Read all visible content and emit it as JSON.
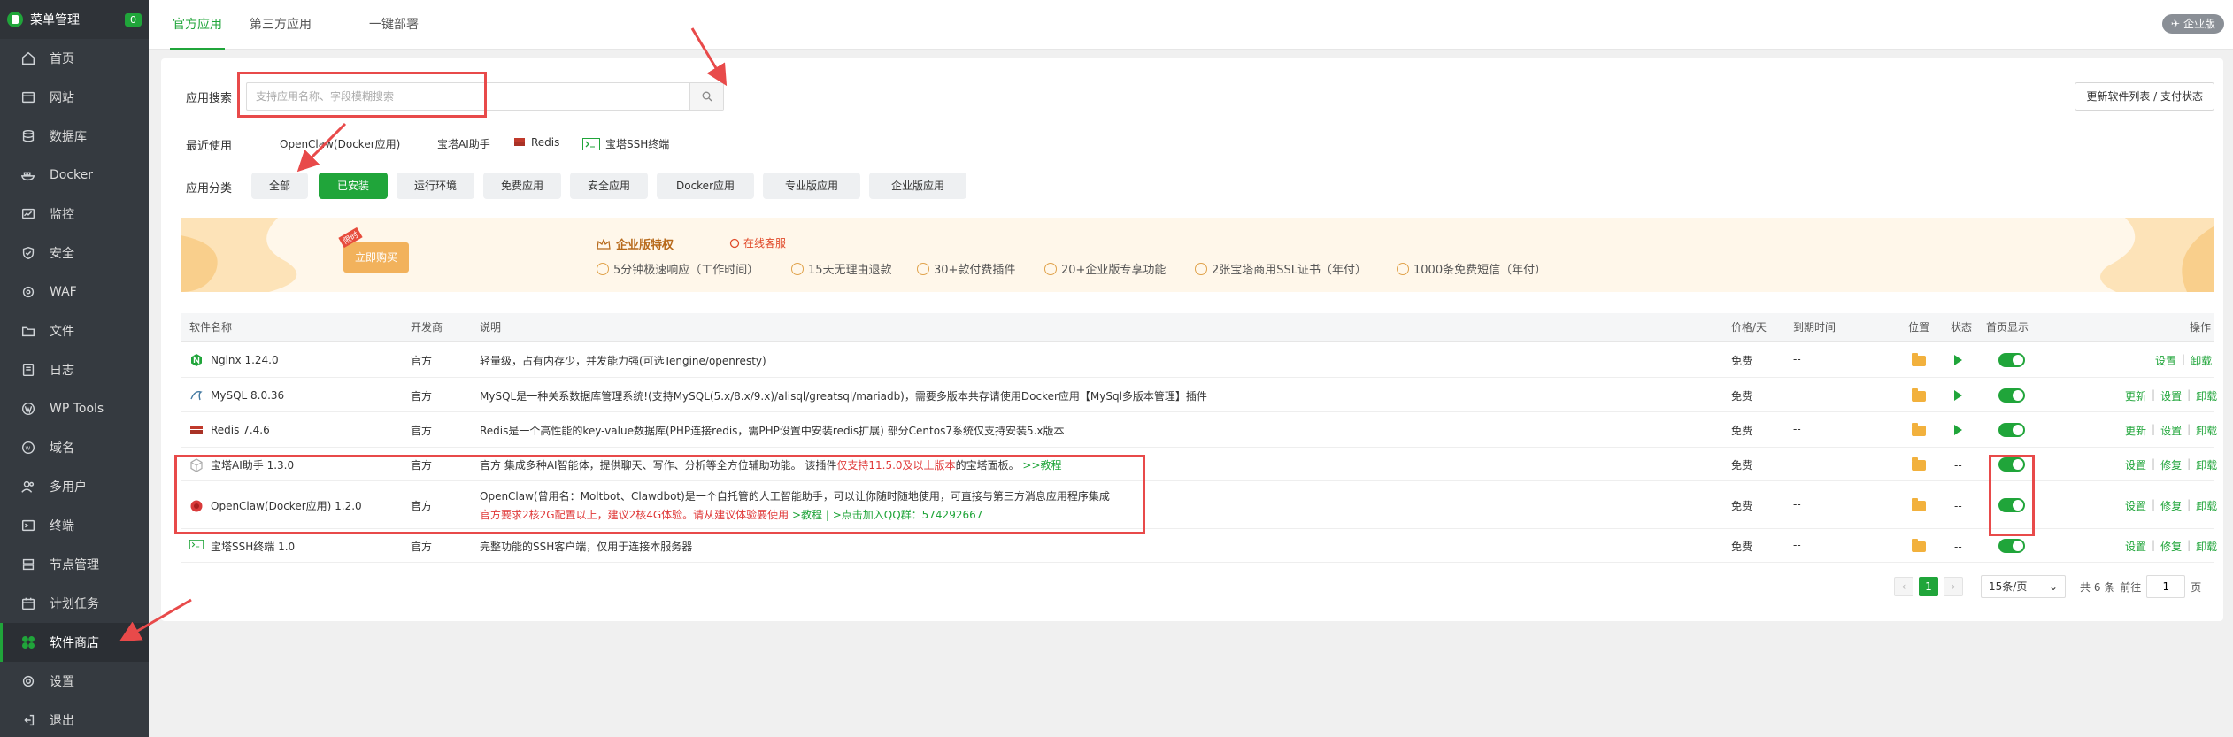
{
  "sidebar": {
    "title": "菜单管理",
    "badge": "0",
    "items": [
      {
        "label": "首页",
        "icon": "home-icon"
      },
      {
        "label": "网站",
        "icon": "website-icon"
      },
      {
        "label": "数据库",
        "icon": "database-icon"
      },
      {
        "label": "Docker",
        "icon": "docker-icon"
      },
      {
        "label": "监控",
        "icon": "monitor-icon"
      },
      {
        "label": "安全",
        "icon": "shield-icon"
      },
      {
        "label": "WAF",
        "icon": "waf-icon"
      },
      {
        "label": "文件",
        "icon": "folder-icon"
      },
      {
        "label": "日志",
        "icon": "log-icon"
      },
      {
        "label": "WP Tools",
        "icon": "wordpress-icon"
      },
      {
        "label": "域名",
        "icon": "domain-icon"
      },
      {
        "label": "多用户",
        "icon": "users-icon"
      },
      {
        "label": "终端",
        "icon": "terminal-icon"
      },
      {
        "label": "节点管理",
        "icon": "node-icon"
      },
      {
        "label": "计划任务",
        "icon": "calendar-icon"
      },
      {
        "label": "软件商店",
        "icon": "store-icon",
        "active": true
      },
      {
        "label": "设置",
        "icon": "gear-icon"
      },
      {
        "label": "退出",
        "icon": "logout-icon"
      }
    ]
  },
  "top_tabs": [
    "官方应用",
    "第三方应用",
    "一键部署"
  ],
  "enterprise_badge": "企业版",
  "search": {
    "label": "应用搜索",
    "placeholder": "支持应用名称、字段模糊搜索"
  },
  "update_button": "更新软件列表 / 支付状态",
  "recent": {
    "label": "最近使用",
    "items": [
      "OpenClaw(Docker应用)",
      "宝塔AI助手",
      "Redis",
      "宝塔SSH终端"
    ]
  },
  "categories": {
    "label": "应用分类",
    "items": [
      "全部",
      "已安装",
      "运行环境",
      "免费应用",
      "安全应用",
      "Docker应用",
      "专业版应用",
      "企业版应用"
    ],
    "active": "已安装"
  },
  "banner": {
    "button": "立即购买",
    "tag": "限时",
    "title": "企业版特权",
    "service": "在线客服",
    "features": [
      "5分钟极速响应（工作时间）",
      "15天无理由退款",
      "30+款付费插件",
      "20+企业版专享功能",
      "2张宝塔商用SSL证书（年付）",
      "1000条免费短信（年付）"
    ]
  },
  "table": {
    "headers": [
      "软件名称",
      "开发商",
      "说明",
      "价格/天",
      "到期时间",
      "位置",
      "状态",
      "首页显示",
      "操作"
    ],
    "rows": [
      {
        "name": "Nginx 1.24.0",
        "vendor": "官方",
        "desc": "轻量级，占有内存少，并发能力强(可选Tengine/openresty)",
        "price": "免费",
        "expire": "--",
        "status": "play",
        "ops": [
          "设置",
          "卸载"
        ]
      },
      {
        "name": "MySQL 8.0.36",
        "vendor": "官方",
        "desc": "MySQL是一种关系数据库管理系统!(支持MySQL(5.x/8.x/9.x)/alisql/greatsql/mariadb)，需要多版本共存请使用Docker应用【MySql多版本管理】插件",
        "price": "免费",
        "expire": "--",
        "status": "play",
        "ops": [
          "更新",
          "设置",
          "卸载"
        ]
      },
      {
        "name": "Redis 7.4.6",
        "vendor": "官方",
        "desc": "Redis是一个高性能的key-value数据库(PHP连接redis，需PHP设置中安装redis扩展) 部分Centos7系统仅支持安装5.x版本",
        "price": "免费",
        "expire": "--",
        "status": "play",
        "ops": [
          "更新",
          "设置",
          "卸载"
        ]
      },
      {
        "name": "宝塔AI助手 1.3.0",
        "vendor": "官方",
        "desc": "官方 集成多种AI智能体，提供聊天、写作、分析等全方位辅助功能。 该插件",
        "desc_red": "仅支持11.5.0及以上版本",
        "desc_tail": "的宝塔面板。",
        "desc_link": ">>教程",
        "price": "免费",
        "expire": "--",
        "status": "--",
        "ops": [
          "设置",
          "修复",
          "卸载"
        ]
      },
      {
        "name": "OpenClaw(Docker应用) 1.2.0",
        "vendor": "官方",
        "desc": "OpenClaw(曾用名：Moltbot、Clawdbot)是一个自托管的人工智能助手，可以让你随时随地使用，可直接与第三方消息应用程序集成",
        "desc2_red": "官方要求2核2G配置以上，建议2核4G体验。请从建议体验要使用",
        "desc2_link": ">教程 | >点击加入QQ群：",
        "desc2_qq": "574292667",
        "price": "免费",
        "expire": "--",
        "status": "--",
        "ops": [
          "设置",
          "修复",
          "卸载"
        ]
      },
      {
        "name": "宝塔SSH终端 1.0",
        "vendor": "官方",
        "desc": "完整功能的SSH客户端，仅用于连接本服务器",
        "price": "免费",
        "expire": "--",
        "status": "--",
        "ops": [
          "设置",
          "修复",
          "卸载"
        ]
      }
    ]
  },
  "pager": {
    "current": "1",
    "per_page": "15条/页",
    "total": "共 6 条",
    "goto_label": "前往",
    "goto_value": "1",
    "page_unit": "页"
  },
  "colors": {
    "accent": "#20a53a",
    "annotation": "#e84a4a"
  }
}
